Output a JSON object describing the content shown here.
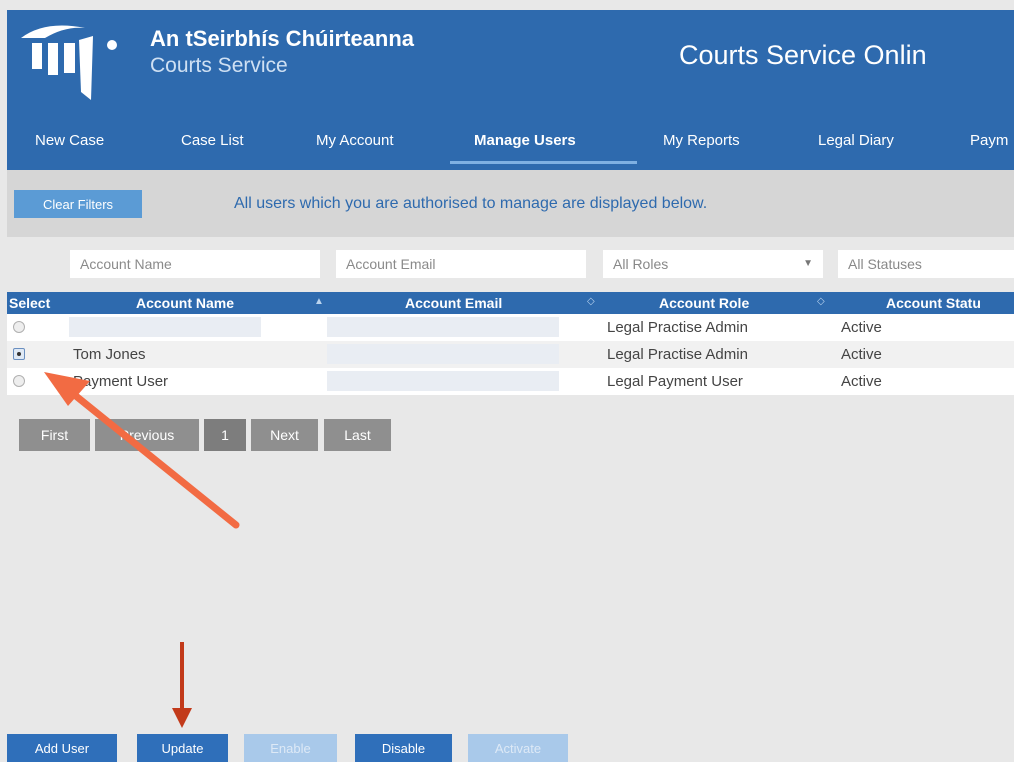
{
  "header": {
    "brand_irish": "An tSeirbhís Chúirteanna",
    "brand_english": "Courts Service",
    "app_title": "Courts Service Onlin",
    "logo_icon": "courts-service-logo-icon"
  },
  "nav": {
    "items": [
      {
        "label": "New Case",
        "active": false
      },
      {
        "label": "Case List",
        "active": false
      },
      {
        "label": "My Account",
        "active": false
      },
      {
        "label": "Manage Users",
        "active": true
      },
      {
        "label": "My Reports",
        "active": false
      },
      {
        "label": "Legal Diary",
        "active": false
      },
      {
        "label": "Paym",
        "active": false
      }
    ]
  },
  "toolbar": {
    "clear_filters_label": "Clear Filters",
    "info_text": "All users which you are authorised to manage are displayed below."
  },
  "filters": {
    "account_name_placeholder": "Account Name",
    "account_email_placeholder": "Account Email",
    "roles_value": "All Roles",
    "statuses_value": "All Statuses"
  },
  "table": {
    "headers": [
      "Select",
      "Account Name",
      "Account Email",
      "Account Role",
      "Account Statu"
    ],
    "rows": [
      {
        "selected": false,
        "name": "",
        "email": "",
        "role": "Legal Practise Admin",
        "status": "Active"
      },
      {
        "selected": true,
        "name": "Tom Jones",
        "email": "",
        "role": "Legal Practise Admin",
        "status": "Active"
      },
      {
        "selected": false,
        "name": "Payment User",
        "email": "",
        "role": "Legal Payment User",
        "status": "Active"
      }
    ]
  },
  "pagination": {
    "first": "First",
    "previous": "Previous",
    "page": "1",
    "next": "Next",
    "last": "Last"
  },
  "actions": {
    "add_user": "Add User",
    "update": "Update",
    "enable": "Enable",
    "disable": "Disable",
    "activate": "Activate"
  },
  "colors": {
    "header_blue": "#2e6aae",
    "button_blue": "#2f6fba",
    "annotation_orange": "#f26b43",
    "annotation_red": "#c23a1a"
  }
}
